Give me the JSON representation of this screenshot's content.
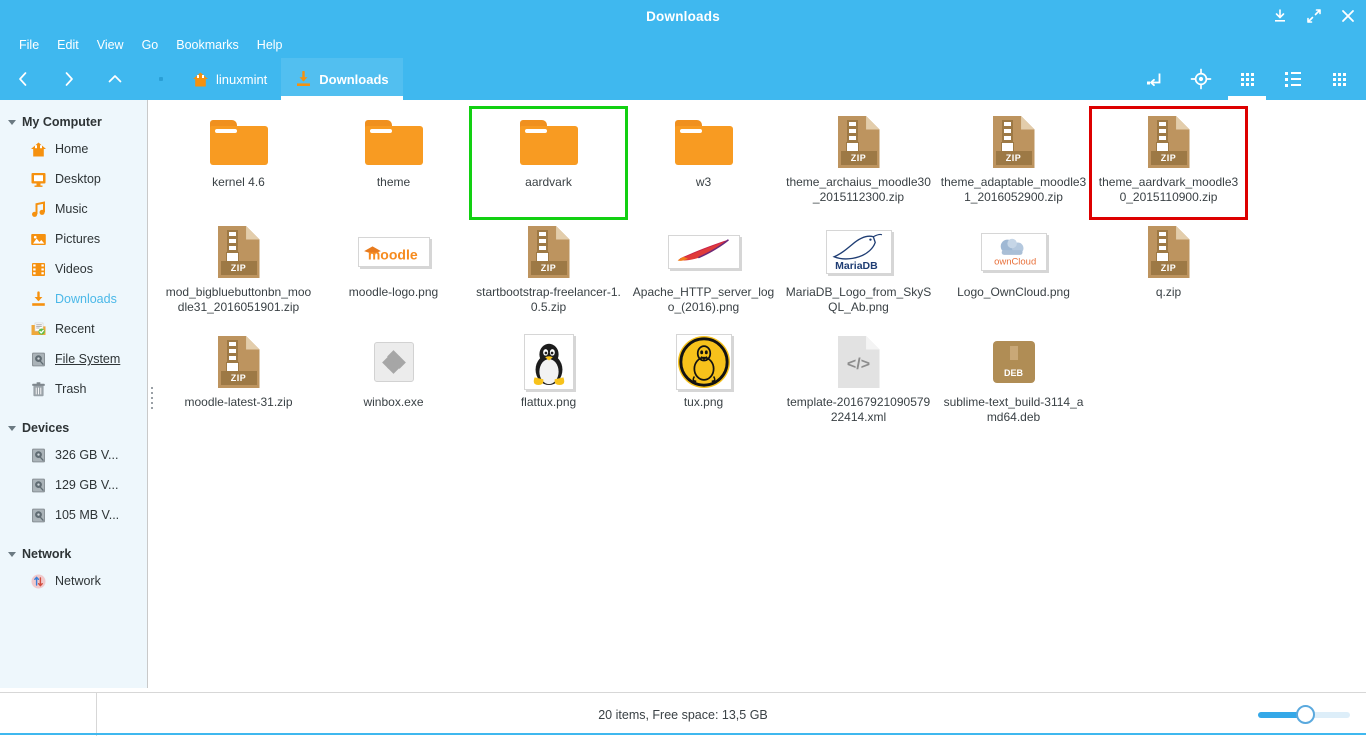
{
  "window": {
    "title": "Downloads",
    "controls": [
      {
        "name": "minimize-button",
        "glyph": "minimize"
      },
      {
        "name": "maximize-button",
        "glyph": "maximize"
      },
      {
        "name": "close-button",
        "glyph": "close"
      }
    ]
  },
  "menubar": {
    "items": [
      "File",
      "Edit",
      "View",
      "Go",
      "Bookmarks",
      "Help"
    ]
  },
  "toolbar": {
    "nav": [
      {
        "name": "back-button",
        "icon": "chevron-left-icon",
        "glyph": "‹"
      },
      {
        "name": "forward-button",
        "icon": "chevron-right-icon",
        "glyph": "›"
      },
      {
        "name": "up-button",
        "icon": "chevron-up-icon",
        "glyph": "⌃"
      },
      {
        "name": "separator-dot",
        "icon": "dot-icon",
        "glyph": ""
      }
    ],
    "breadcrumbs": [
      {
        "label": "linuxmint",
        "icon": "home-icon",
        "active": false
      },
      {
        "label": "Downloads",
        "icon": "downloads-icon",
        "active": true
      }
    ],
    "right_icons": [
      {
        "name": "toggle-location-entry-button",
        "icon": "path-entry-icon"
      },
      {
        "name": "search-button",
        "icon": "target-icon"
      },
      {
        "name": "icon-view-button",
        "icon": "grid-view-icon"
      },
      {
        "name": "list-view-button",
        "icon": "list-view-icon"
      },
      {
        "name": "compact-view-button",
        "icon": "compact-view-icon"
      }
    ]
  },
  "sidebar": {
    "groups": [
      {
        "name": "My Computer",
        "items": [
          {
            "label": "Home",
            "icon": "home-icon",
            "state": "normal"
          },
          {
            "label": "Desktop",
            "icon": "desktop-icon",
            "state": "normal"
          },
          {
            "label": "Music",
            "icon": "music-note-icon",
            "state": "normal"
          },
          {
            "label": "Pictures",
            "icon": "pictures-icon",
            "state": "normal"
          },
          {
            "label": "Videos",
            "icon": "videos-icon",
            "state": "normal"
          },
          {
            "label": "Downloads",
            "icon": "downloads-icon",
            "state": "active"
          },
          {
            "label": "Recent",
            "icon": "recent-icon",
            "state": "normal"
          },
          {
            "label": "File System",
            "icon": "drive-icon",
            "state": "hovered"
          },
          {
            "label": "Trash",
            "icon": "trash-icon",
            "state": "normal"
          }
        ]
      },
      {
        "name": "Devices",
        "items": [
          {
            "label": "326 GB V...",
            "icon": "drive-icon",
            "state": "normal"
          },
          {
            "label": "129 GB V...",
            "icon": "drive-icon",
            "state": "normal"
          },
          {
            "label": "105 MB V...",
            "icon": "drive-icon",
            "state": "normal"
          }
        ]
      },
      {
        "name": "Network",
        "items": [
          {
            "label": "Network",
            "icon": "network-icon",
            "state": "normal"
          }
        ]
      }
    ]
  },
  "files": [
    {
      "name": "kernel 4.6",
      "icon": "folder-icon",
      "highlight": "none"
    },
    {
      "name": "theme",
      "icon": "folder-icon",
      "highlight": "none"
    },
    {
      "name": "aardvark",
      "icon": "folder-icon",
      "highlight": "green"
    },
    {
      "name": "w3",
      "icon": "folder-icon",
      "highlight": "none"
    },
    {
      "name": "theme_archaius_moodle30_2015112300.zip",
      "icon": "zip-icon",
      "highlight": "none"
    },
    {
      "name": "theme_adaptable_moodle31_2016052900.zip",
      "icon": "zip-icon",
      "highlight": "none"
    },
    {
      "name": "theme_aardvark_moodle30_2015110900.zip",
      "icon": "zip-icon",
      "highlight": "red"
    },
    {
      "name": "mod_bigbluebuttonbn_moodle31_2016051901.zip",
      "icon": "zip-icon",
      "highlight": "none"
    },
    {
      "name": "moodle-logo.png",
      "icon": "moodle-logo-thumbnail",
      "highlight": "none"
    },
    {
      "name": "startbootstrap-freelancer-1.0.5.zip",
      "icon": "zip-icon",
      "highlight": "none"
    },
    {
      "name": "Apache_HTTP_server_logo_(2016).png",
      "icon": "apache-feather-thumbnail",
      "highlight": "none"
    },
    {
      "name": "MariaDB_Logo_from_SkySQL_Ab.png",
      "icon": "mariadb-seal-thumbnail",
      "highlight": "none"
    },
    {
      "name": "Logo_OwnCloud.png",
      "icon": "owncloud-thumbnail",
      "highlight": "none"
    },
    {
      "name": "q.zip",
      "icon": "zip-icon",
      "highlight": "none"
    },
    {
      "name": "moodle-latest-31.zip",
      "icon": "zip-icon",
      "highlight": "none"
    },
    {
      "name": "winbox.exe",
      "icon": "exe-icon",
      "highlight": "none"
    },
    {
      "name": "flattux.png",
      "icon": "tux-penguin-thumbnail",
      "highlight": "none"
    },
    {
      "name": "tux.png",
      "icon": "tux-badge-thumbnail",
      "highlight": "none"
    },
    {
      "name": "template-2016792109057922414.xml",
      "icon": "xml-icon",
      "highlight": "none"
    },
    {
      "name": "sublime-text_build-3114_amd64.deb",
      "icon": "deb-icon",
      "highlight": "none"
    }
  ],
  "labels": {
    "zip_badge": "ZIP",
    "deb_badge": "DEB",
    "xml_glyph": "</>",
    "moodle_text": "moodle",
    "mariadb_text": "MariaDB",
    "owncloud_text": "ownCloud"
  },
  "statusbar": {
    "text": "20 items, Free space: 13,5 GB",
    "zoom_fill_percent": 50
  },
  "colors": {
    "accent": "#3fb8ef",
    "sidebar_bg": "#eef7fc",
    "sidebar_active": "#4ab8e8",
    "folder": "#f89b22",
    "zip": "#bd945f",
    "highlight_green": "#12d012",
    "highlight_red": "#dd0000"
  }
}
